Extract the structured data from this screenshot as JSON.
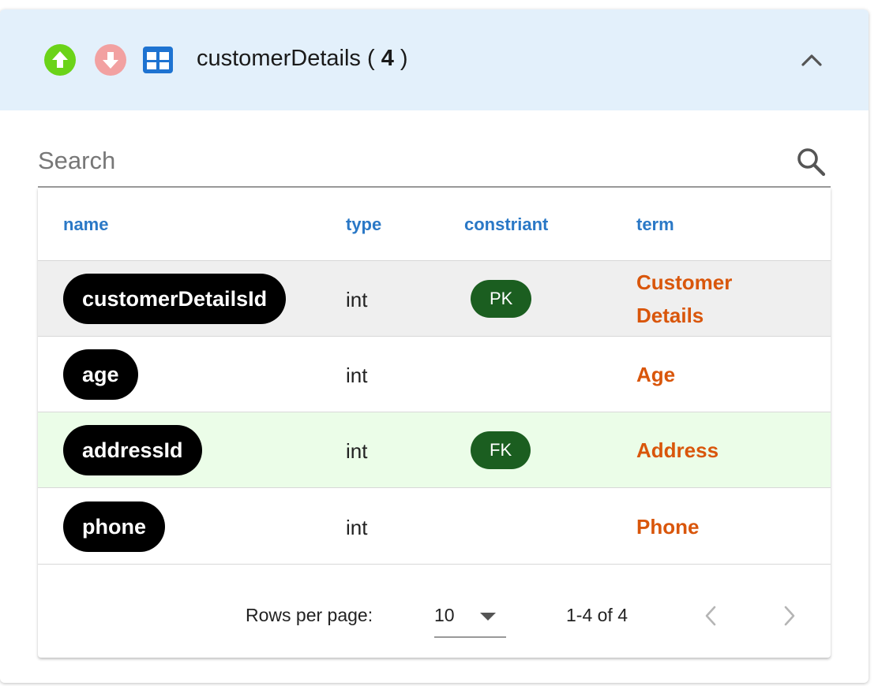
{
  "header": {
    "table_name": "customerDetails",
    "open_paren": "(",
    "count": "4",
    "close_paren": ")",
    "icons": [
      "arrow-upward-circle-icon",
      "arrow-downward-circle-icon",
      "table-icon",
      "chevron-up-icon"
    ],
    "colors": {
      "up": "#6bd318",
      "down": "#f2a1a1",
      "table": "#1e73d1",
      "background": "#e3f0fb"
    }
  },
  "search": {
    "placeholder": "Search",
    "value": ""
  },
  "columns": [
    "name",
    "type",
    "constriant",
    "term"
  ],
  "rows": [
    {
      "name": "customerDetailsId",
      "type": "int",
      "constraint": "PK",
      "term": "Customer Details",
      "state": "selected"
    },
    {
      "name": "age",
      "type": "int",
      "constraint": "",
      "term": "Age",
      "state": "normal"
    },
    {
      "name": "addressId",
      "type": "int",
      "constraint": "FK",
      "term": "Address",
      "state": "foreign-key"
    },
    {
      "name": "phone",
      "type": "int",
      "constraint": "",
      "term": "Phone",
      "state": "normal"
    }
  ],
  "pagination": {
    "rows_per_page_label": "Rows per page:",
    "rows_per_page": "10",
    "range": "1-4 of 4",
    "prev_enabled": false,
    "next_enabled": false
  },
  "colors": {
    "header_text": "#2a78c6",
    "term_text": "#d9560b",
    "chip": "#1b5e20",
    "selected_row": "#efefef",
    "fk_row": "#ebfde8"
  }
}
